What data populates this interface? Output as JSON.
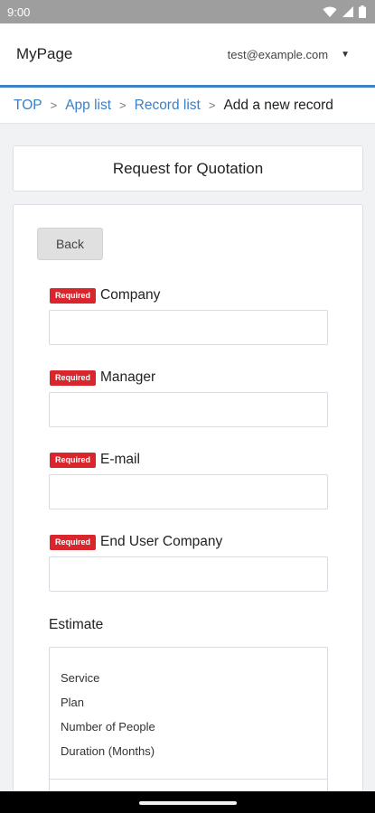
{
  "status_bar": {
    "time": "9:00",
    "icons": [
      "wifi-icon",
      "signal-icon",
      "battery-icon"
    ]
  },
  "header": {
    "title": "MyPage",
    "user_email": "test@example.com",
    "accent_color": "#3b82c4"
  },
  "breadcrumb": {
    "items": [
      "TOP",
      "App list",
      "Record list"
    ],
    "current": "Add a new record",
    "separator": ">"
  },
  "page_title": "Request for Quotation",
  "form": {
    "back_label": "Back",
    "required_label": "Required",
    "required_color": "#d9262c",
    "fields": [
      {
        "label": "Company",
        "value": ""
      },
      {
        "label": "Manager",
        "value": ""
      },
      {
        "label": "E-mail",
        "value": ""
      },
      {
        "label": "End User Company",
        "value": ""
      }
    ],
    "estimate": {
      "label": "Estimate",
      "rows": [
        "Service",
        "Plan",
        "Number of People",
        "Duration (Months)"
      ]
    }
  }
}
